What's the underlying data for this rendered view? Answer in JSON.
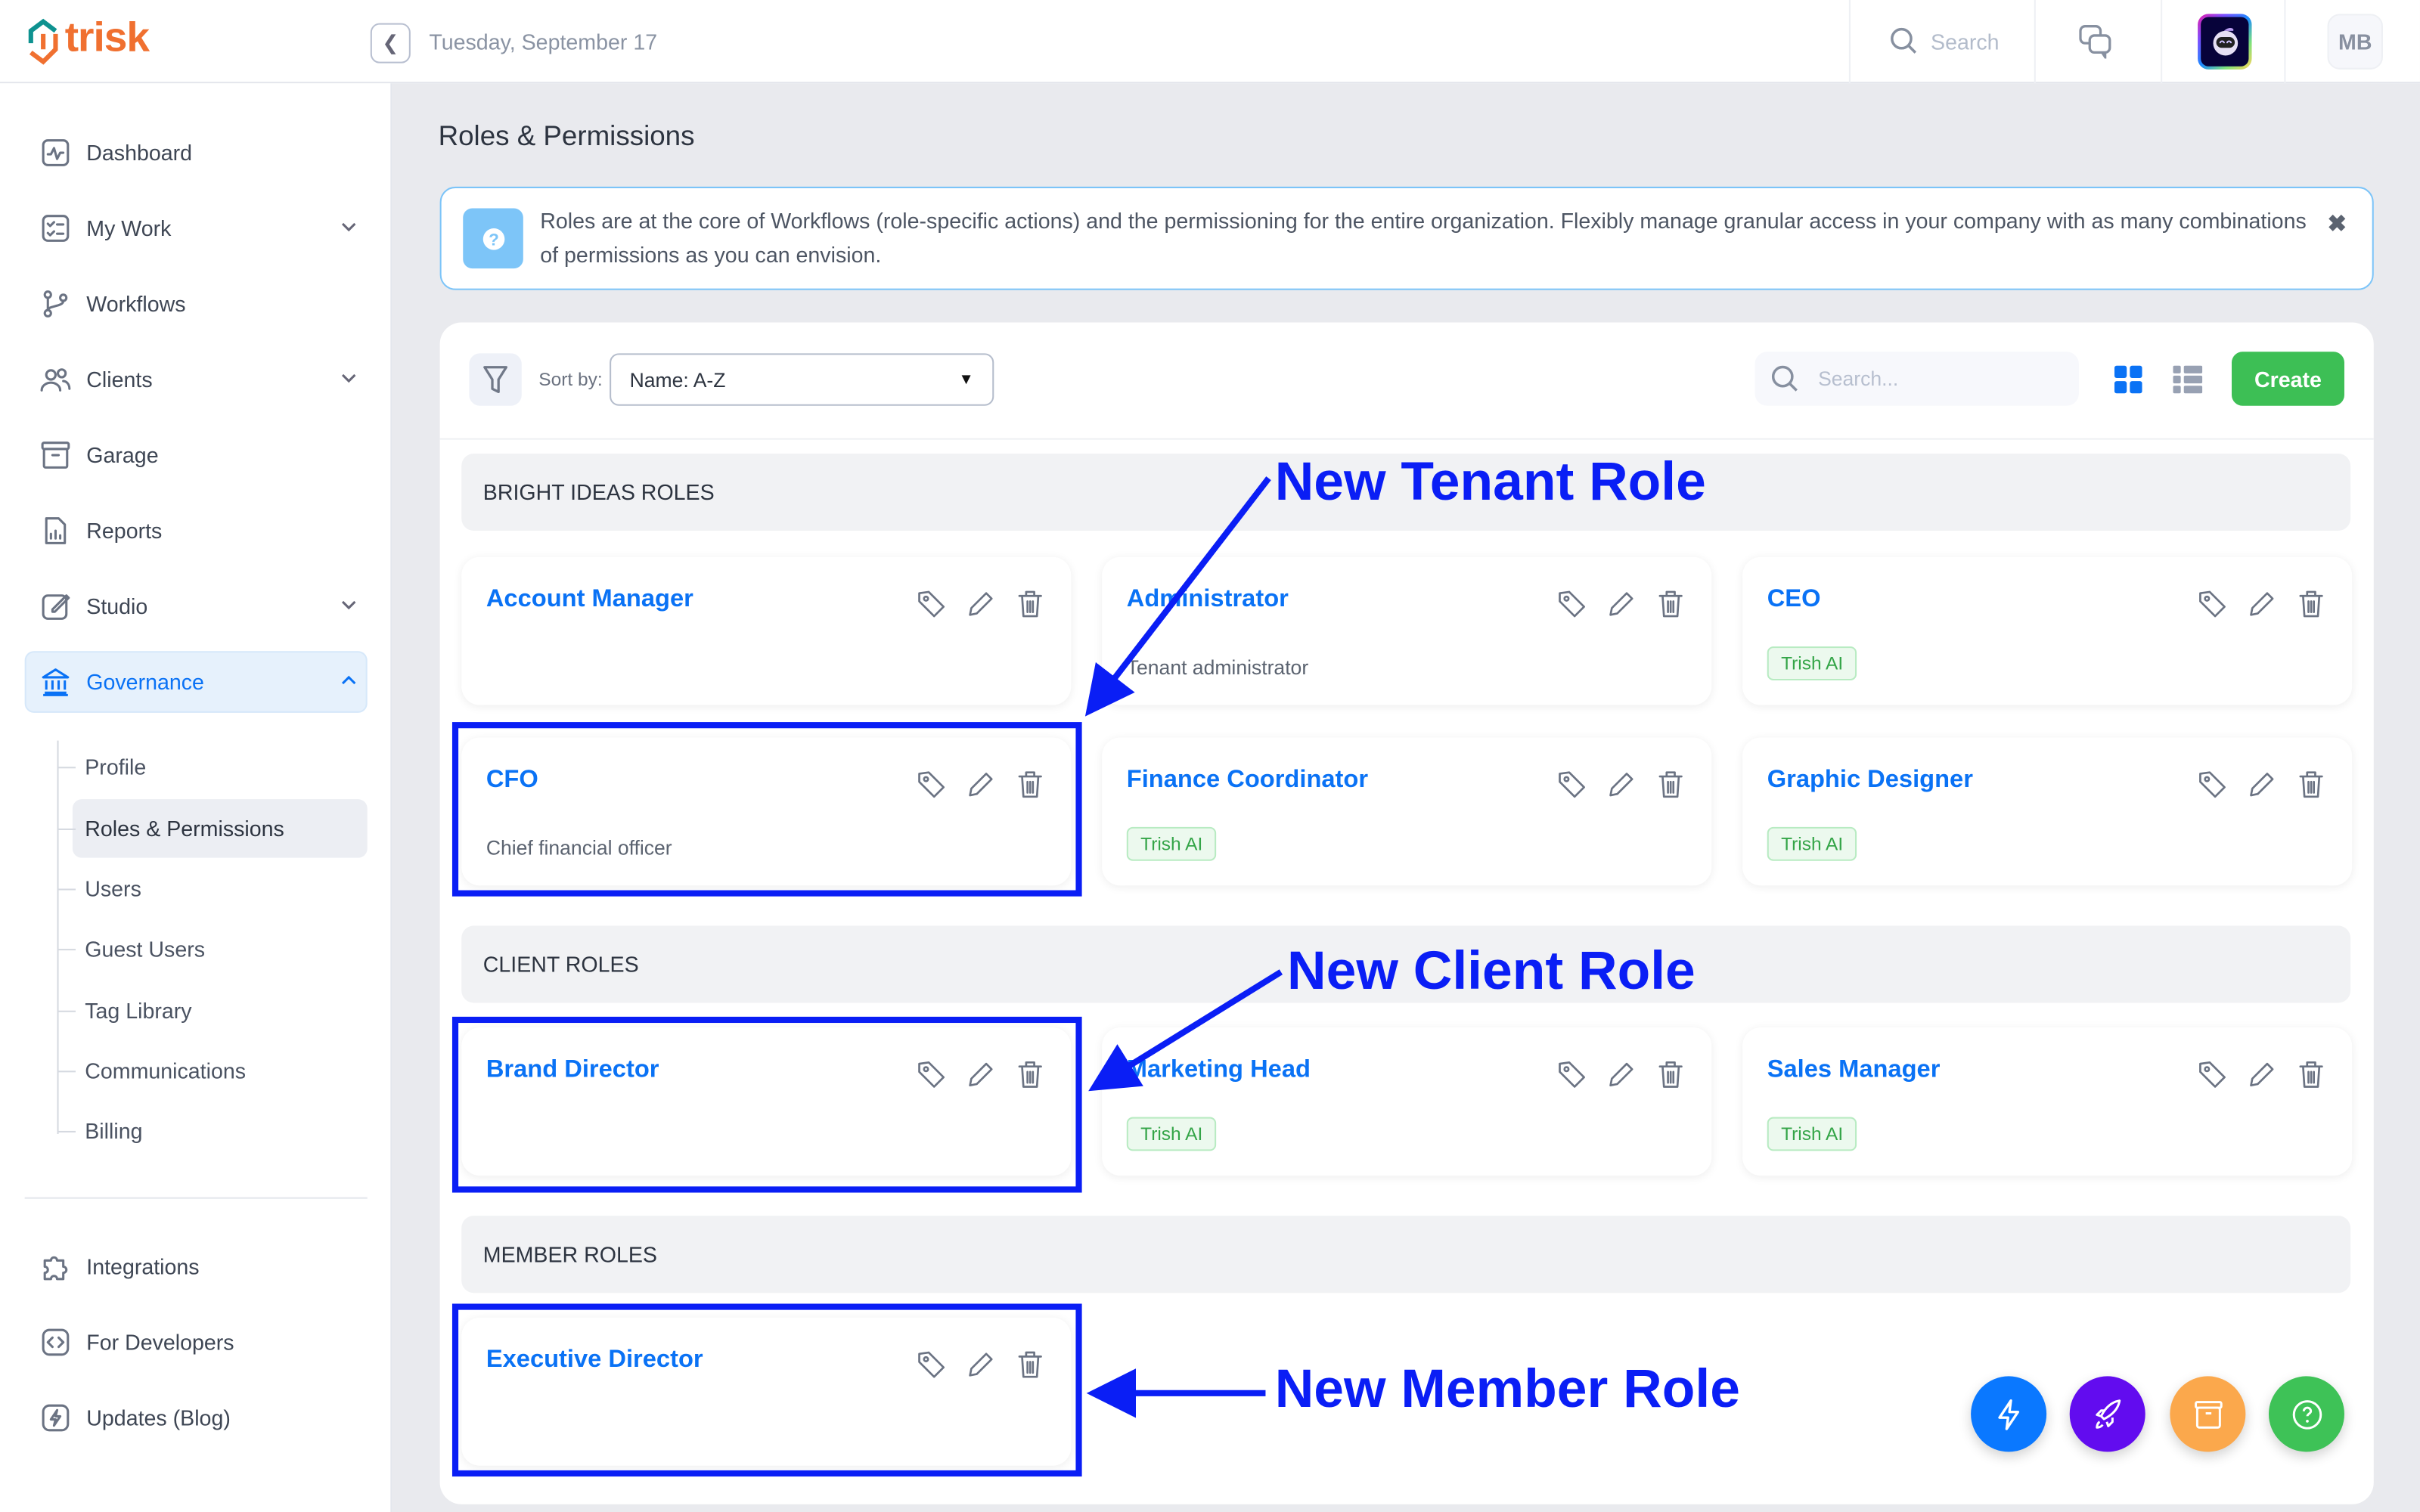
{
  "app": {
    "logo": "trisk",
    "date": "Tuesday, September 17"
  },
  "topbar": {
    "search_label": "Search",
    "user_initials": "MB"
  },
  "sidebar": {
    "items": [
      {
        "label": "Dashboard",
        "icon": "activity-icon"
      },
      {
        "label": "My Work",
        "icon": "checklist-icon",
        "expandable": true
      },
      {
        "label": "Workflows",
        "icon": "branch-icon"
      },
      {
        "label": "Clients",
        "icon": "users-icon",
        "expandable": true
      },
      {
        "label": "Garage",
        "icon": "archive-icon"
      },
      {
        "label": "Reports",
        "icon": "report-icon"
      },
      {
        "label": "Studio",
        "icon": "edit-icon",
        "expandable": true
      },
      {
        "label": "Governance",
        "icon": "bank-icon",
        "expanded": true,
        "active": true
      }
    ],
    "governance_sub": [
      "Profile",
      "Roles & Permissions",
      "Users",
      "Guest Users",
      "Tag Library",
      "Communications",
      "Billing"
    ],
    "selected_sub": "Roles & Permissions",
    "bottom_items": [
      {
        "label": "Integrations",
        "icon": "puzzle-icon"
      },
      {
        "label": "For Developers",
        "icon": "code-icon"
      },
      {
        "label": "Updates (Blog)",
        "icon": "bolt-icon"
      }
    ]
  },
  "page": {
    "title": "Roles & Permissions",
    "banner": "Roles are at the core of Workflows (role-specific actions) and the permissioning for the entire organization. Flexibly manage granular access in your company with as many combinations of permissions as you can envision.",
    "sort_label": "Sort by:",
    "sort_value": "Name: A-Z",
    "search_placeholder": "Search...",
    "create_label": "Create",
    "view_mode": "grid"
  },
  "sections": [
    {
      "title": "BRIGHT IDEAS ROLES",
      "roles": [
        {
          "name": "Account Manager",
          "desc": "",
          "badge": ""
        },
        {
          "name": "Administrator",
          "desc": "Tenant administrator",
          "badge": ""
        },
        {
          "name": "CEO",
          "desc": "",
          "badge": "Trish AI"
        },
        {
          "name": "CFO",
          "desc": "Chief financial officer",
          "badge": ""
        },
        {
          "name": "Finance Coordinator",
          "desc": "",
          "badge": "Trish AI"
        },
        {
          "name": "Graphic Designer",
          "desc": "",
          "badge": "Trish AI"
        }
      ]
    },
    {
      "title": "CLIENT ROLES",
      "roles": [
        {
          "name": "Brand Director",
          "desc": "",
          "badge": ""
        },
        {
          "name": "Marketing Head",
          "desc": "",
          "badge": "Trish AI"
        },
        {
          "name": "Sales Manager",
          "desc": "",
          "badge": "Trish AI"
        }
      ]
    },
    {
      "title": "MEMBER ROLES",
      "roles": [
        {
          "name": "Executive Director",
          "desc": "",
          "badge": ""
        }
      ]
    }
  ],
  "annotations": [
    "New Tenant Role",
    "New Client Role",
    "New Member Role"
  ],
  "fabs": [
    {
      "name": "quick-actions",
      "icon": "lightning-icon",
      "color": "#0a78ff"
    },
    {
      "name": "launch",
      "icon": "rocket-icon",
      "color": "#620cef"
    },
    {
      "name": "archive",
      "icon": "archive-icon",
      "color": "#fba84c"
    },
    {
      "name": "help",
      "icon": "help-icon",
      "color": "#3ec257"
    }
  ],
  "colors": {
    "accent": "#0a72f5",
    "create": "#3dbf55",
    "annotation": "#0a1ef5",
    "logo": "#f07030",
    "logo_teal": "#0e9290"
  }
}
